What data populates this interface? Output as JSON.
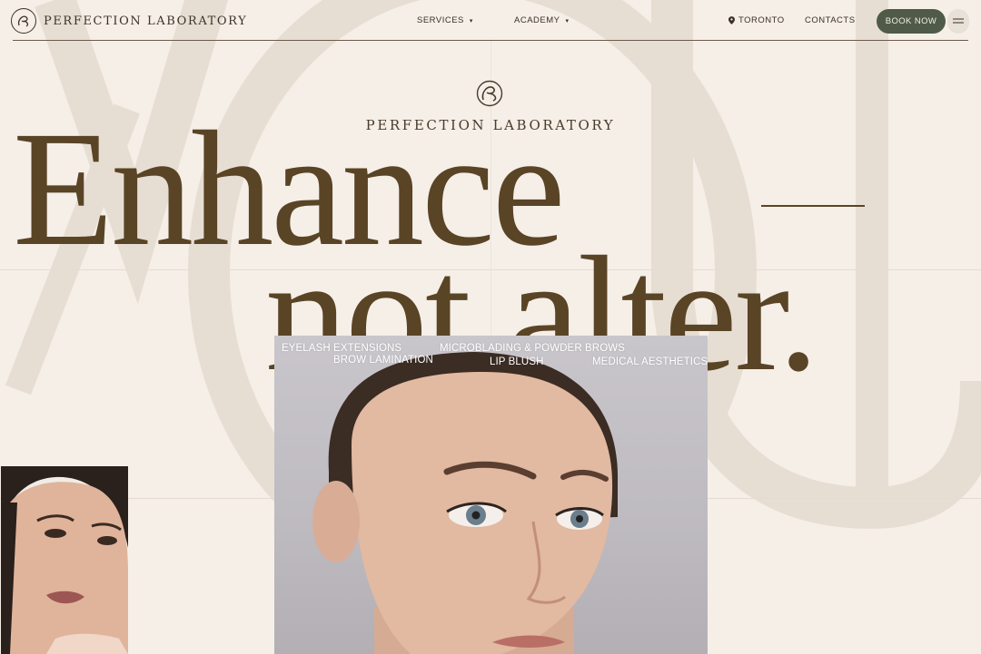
{
  "brand": {
    "name": "PERFECTION LABORATORY"
  },
  "nav": {
    "services": "SERVICES",
    "academy": "ACADEMY",
    "location": "TORONTO",
    "contacts": "CONTACTS",
    "book": "BOOK NOW",
    "caret": "▾"
  },
  "hero": {
    "line1": "Enhance",
    "line2": "not alter."
  },
  "services": {
    "eyelash": "EYELASH EXTENSIONS",
    "brow_lamination": "BROW LAMINATION",
    "microblading": "MICROBLADING & POWDER BROWS",
    "lip_blush": "LIP BLUSH",
    "medical": "MEDICAL AESTHETICS"
  },
  "colors": {
    "background": "#f5efe8",
    "text": "#5a4426",
    "accent_button": "#4f5b48"
  },
  "icons": [
    "logo-mark-icon",
    "caret-down-icon",
    "location-pin-icon",
    "hamburger-menu-icon"
  ]
}
